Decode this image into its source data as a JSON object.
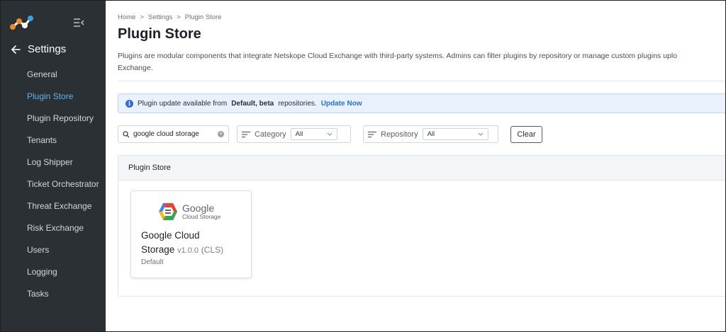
{
  "sidebar": {
    "section_title": "Settings",
    "items": [
      {
        "label": "General"
      },
      {
        "label": "Plugin Store"
      },
      {
        "label": "Plugin Repository"
      },
      {
        "label": "Tenants"
      },
      {
        "label": "Log Shipper"
      },
      {
        "label": "Ticket Orchestrator"
      },
      {
        "label": "Threat Exchange"
      },
      {
        "label": "Risk Exchange"
      },
      {
        "label": "Users"
      },
      {
        "label": "Logging"
      },
      {
        "label": "Tasks"
      }
    ],
    "active_item": "Plugin Store"
  },
  "breadcrumb": {
    "items": [
      "Home",
      "Settings",
      "Plugin Store"
    ],
    "separator": ">"
  },
  "page": {
    "title": "Plugin Store",
    "description_line1": "Plugins are modular components that integrate Netskope Cloud Exchange with third-party systems. Admins can filter plugins by repository or manage custom plugins uplo",
    "description_line2": "Exchange."
  },
  "alert": {
    "prefix": "Plugin update available from",
    "repos": "Default, beta",
    "suffix": "repositories.",
    "action": "Update Now"
  },
  "filters": {
    "search_value": "google cloud storage",
    "category_label": "Category",
    "category_value": "All",
    "repository_label": "Repository",
    "repository_value": "All",
    "clear_label": "Clear"
  },
  "panel": {
    "title": "Plugin Store"
  },
  "plugins": [
    {
      "logo_text": "Google",
      "logo_subtext": "Cloud Storage",
      "name_line1": "Google Cloud",
      "name_line2": "Storage",
      "version": "v1.0.0",
      "tag": "(CLS)",
      "repository": "Default"
    }
  ],
  "colors": {
    "sidebar_bg": "#2b3034",
    "active_nav": "#5cb3ef",
    "link_blue": "#2b6fd6",
    "alert_bg": "#e8f1fc"
  },
  "icons": {
    "logo": "netskope-logo-icon",
    "collapse": "menu-collapse-icon",
    "back": "arrow-left-icon",
    "info": "info-icon",
    "search": "search-icon",
    "clear_search": "clear-circle-icon",
    "filter": "filter-lines-icon",
    "dropdown": "chevron-down-icon"
  }
}
